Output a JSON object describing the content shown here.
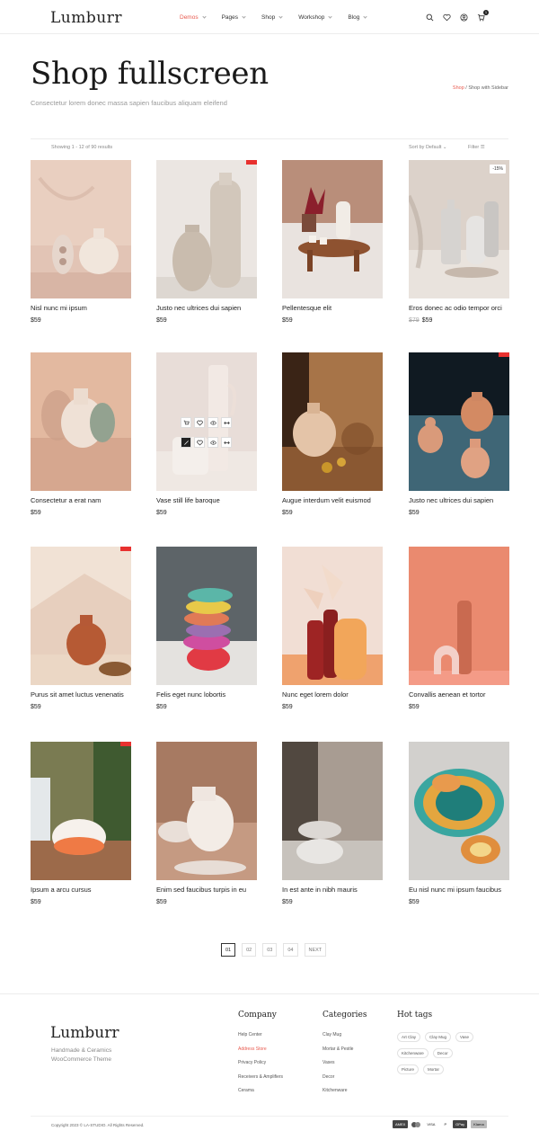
{
  "header": {
    "logo": "Lumburr",
    "nav": [
      {
        "label": "Demos",
        "active": true
      },
      {
        "label": "Pages",
        "active": false
      },
      {
        "label": "Shop",
        "active": false
      },
      {
        "label": "Workshop",
        "active": false
      },
      {
        "label": "Blog",
        "active": false
      }
    ],
    "icons": [
      "search-icon",
      "heart-icon",
      "user-icon",
      "cart-icon"
    ],
    "cart_count": "1"
  },
  "title_block": {
    "title": "Shop fullscreen",
    "subtitle": "Consectetur lorem donec massa sapien faucibus aliquam eleifend",
    "breadcrumb_link": "Shop",
    "breadcrumb_current": "Shop with Sidebar"
  },
  "toolbar": {
    "results": "Showing 1 - 12 of 90 results",
    "sort": "Sort by Default",
    "filter": "Filter"
  },
  "products": [
    {
      "name": "Nisl nunc mi ipsum",
      "price": "$59"
    },
    {
      "name": "Justo nec ultrices dui sapien",
      "price": "$59",
      "red_tag": true
    },
    {
      "name": "Pellentesque elit",
      "price": "$59"
    },
    {
      "name": "Eros donec ac odio tempor orci",
      "old_price": "$79",
      "price": "$59",
      "sale": "-15%"
    },
    {
      "name": "Consectetur a erat nam",
      "price": "$59"
    },
    {
      "name": "Vase still life baroque",
      "price": "$59",
      "quick": true
    },
    {
      "name": "Augue interdum velit euismod",
      "price": "$59"
    },
    {
      "name": "Justo nec ultrices dui sapien",
      "price": "$59",
      "red_tag": true
    },
    {
      "name": "Purus sit amet luctus venenatis",
      "price": "$59",
      "red_tag": true
    },
    {
      "name": "Felis eget nunc lobortis",
      "price": "$59"
    },
    {
      "name": "Nunc eget lorem dolor",
      "price": "$59"
    },
    {
      "name": "Convallis aenean et tortor",
      "price": "$59"
    },
    {
      "name": "Ipsum a arcu cursus",
      "price": "$59",
      "red_tag": true
    },
    {
      "name": "Enim sed faucibus turpis in eu",
      "price": "$59"
    },
    {
      "name": "In est ante in nibh mauris",
      "price": "$59"
    },
    {
      "name": "Eu nisl nunc mi ipsum faucibus",
      "price": "$59"
    }
  ],
  "pagination": [
    "01",
    "02",
    "03",
    "04",
    "NEXT"
  ],
  "footer": {
    "logo": "Lumburr",
    "tagline_1": "Handmade & Ceramics",
    "tagline_2": "WooCommerce Theme",
    "company": {
      "title": "Company",
      "links": [
        "Help Center",
        "Address Store",
        "Privacy Policy",
        "Receivers & Amplifiers",
        "Cerama"
      ]
    },
    "categories": {
      "title": "Categories",
      "links": [
        "Clay Mug",
        "Mortar & Pestle",
        "Vases",
        "Decor",
        "Kitchenware"
      ]
    },
    "hot_tags": {
      "title": "Hot tags",
      "tags": [
        "Art Clay",
        "Clay Mug",
        "Vase",
        "Kitchenware",
        "Decor",
        "Picture",
        "Mortar"
      ]
    },
    "copyright": "Copyright 2023 © LA-STUDIO. All Rights Reserved.",
    "payments": [
      "AMEX",
      "",
      "VISA",
      "P",
      "GPay",
      "Klarna"
    ]
  },
  "colors": {
    "accent": "#e85a4f",
    "badge": "#e8312f"
  }
}
